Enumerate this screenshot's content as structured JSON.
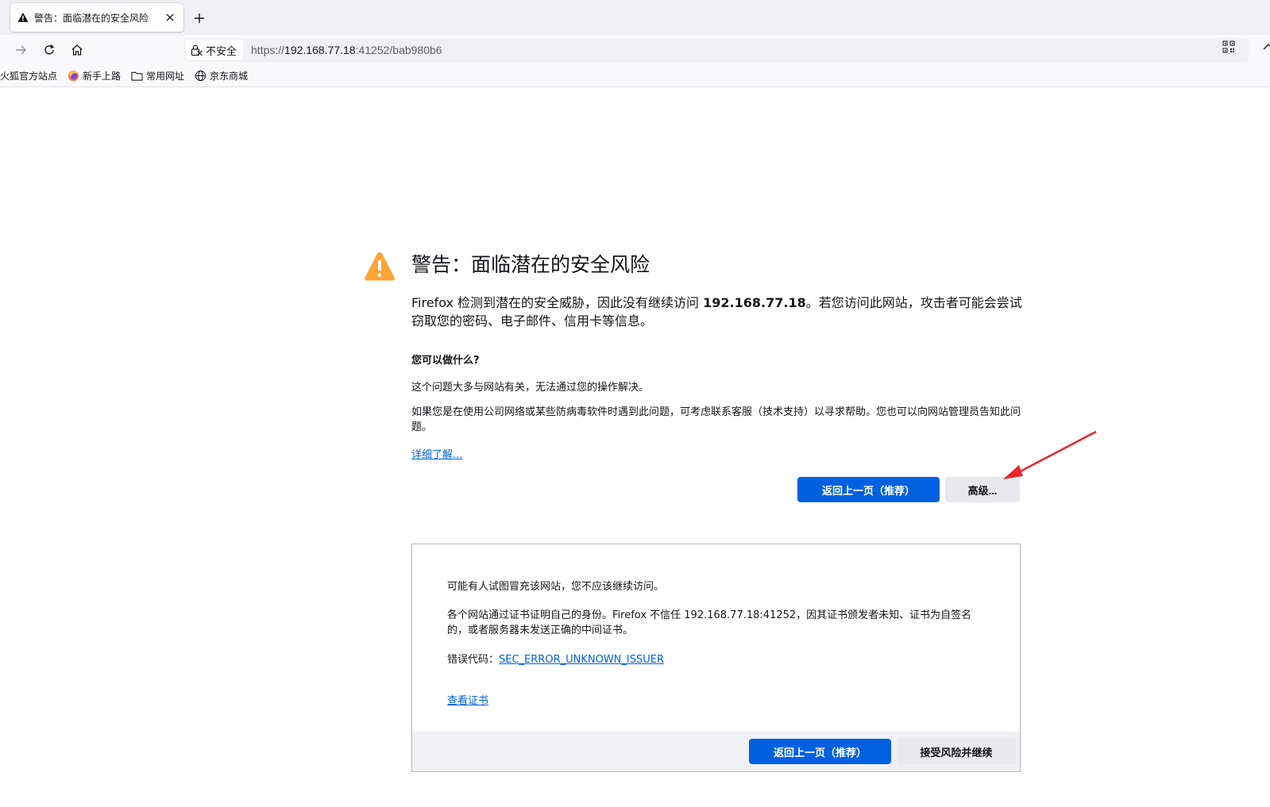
{
  "tab": {
    "title": "警告：面临潜在的安全风险",
    "close_glyph": "×",
    "new_tab_glyph": "+"
  },
  "toolbar": {
    "security_label": "不安全",
    "url_scheme": "https://",
    "url_host": "192.168.77.18",
    "url_rest": ":41252/bab980b6"
  },
  "bookmarks": [
    {
      "label": "火狐官方站点",
      "icon": "none"
    },
    {
      "label": "新手上路",
      "icon": "firefox-icon"
    },
    {
      "label": "常用网址",
      "icon": "folder-icon"
    },
    {
      "label": "京东商城",
      "icon": "globe-icon"
    }
  ],
  "error": {
    "title": "警告：面临潜在的安全风险",
    "intro_prefix": "Firefox 检测到潜在的安全威胁，因此没有继续访问 ",
    "intro_host": "192.168.77.18",
    "intro_suffix": "。若您访问此网站，攻击者可能会尝试窃取您的密码、电子邮件、信用卡等信息。",
    "what_title": "您可以做什么?",
    "what_p1": "这个问题大多与网站有关，无法通过您的操作解决。",
    "what_p2": "如果您是在使用公司网络或某些防病毒软件时遇到此问题，可考虑联系客服（技术支持）以寻求帮助。您也可以向网站管理员告知此问题。",
    "learn_more": "详细了解...",
    "go_back_label": "返回上一页（推荐）",
    "advanced_label": "高级..."
  },
  "advanced": {
    "p1": "可能有人试图冒充该网站，您不应该继续访问。",
    "p2": "各个网站通过证书证明自己的身份。Firefox 不信任 192.168.77.18:41252，因其证书颁发者未知、证书为自签名的，或者服务器未发送正确的中间证书。",
    "error_code_label": "错误代码：",
    "error_code": "SEC_ERROR_UNKNOWN_ISSUER",
    "view_cert": "查看证书",
    "go_back_label": "返回上一页（推荐）",
    "accept_label": "接受风险并继续"
  },
  "colors": {
    "warning": "#ffa436",
    "accent_blue": "#0061e0",
    "annotation_red": "#e8262b"
  }
}
